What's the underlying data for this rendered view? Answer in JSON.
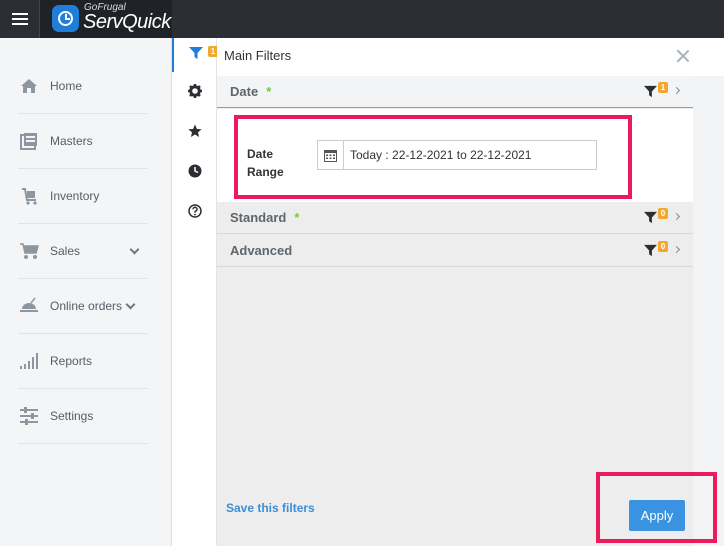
{
  "brand": {
    "sub": "GoFrugal",
    "main": "ServQuick"
  },
  "sidebar": {
    "items": [
      {
        "label": "Home",
        "icon": "home-icon"
      },
      {
        "label": "Masters",
        "icon": "masters-icon"
      },
      {
        "label": "Inventory",
        "icon": "inventory-icon"
      },
      {
        "label": "Sales",
        "icon": "cart-icon",
        "expandable": true
      },
      {
        "label": "Online orders",
        "icon": "online-orders-icon",
        "expandable": true
      },
      {
        "label": "Reports",
        "icon": "reports-icon"
      },
      {
        "label": "Settings",
        "icon": "settings-sliders-icon"
      }
    ]
  },
  "rail": {
    "filter_badge": "1",
    "items": [
      "filter-icon",
      "gear-icon",
      "star-icon",
      "clock-icon",
      "help-icon"
    ]
  },
  "panel": {
    "title": "Main Filters",
    "sections": {
      "date": {
        "title": "Date",
        "required": "*",
        "badge": "1"
      },
      "standard": {
        "title": "Standard",
        "required": "*",
        "badge": "0"
      },
      "advanced": {
        "title": "Advanced",
        "badge": "0"
      }
    },
    "date_range": {
      "label_line1": "Date",
      "label_line2": "Range",
      "value": "Today : 22-12-2021 to 22-12-2021"
    },
    "save_link": "Save this filters",
    "apply_label": "Apply"
  },
  "colors": {
    "accent": "#3a93e0",
    "highlight": "#ec1a5b",
    "badge": "#f0a830",
    "required": "#6fcf3a",
    "topbar": "#2b2f33"
  }
}
